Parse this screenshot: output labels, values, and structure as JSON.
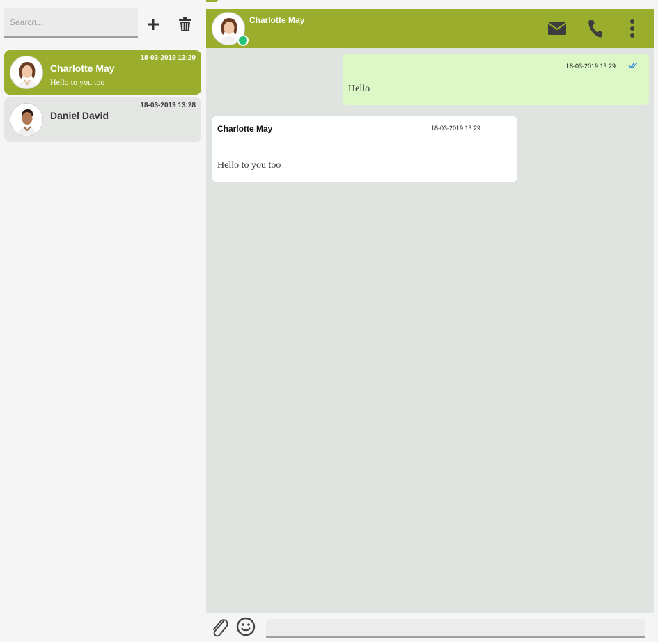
{
  "colors": {
    "accent": "#9aad2c",
    "online": "#22c377",
    "outgoing_bubble": "#dcf8c6",
    "chat_background": "#e0e4e0",
    "read_ticks": "#3a8fd6"
  },
  "sidebar": {
    "search": {
      "placeholder": "Search...",
      "value": ""
    },
    "add_icon": "plus-icon",
    "delete_icon": "trash-icon",
    "contacts": [
      {
        "name": "Charlotte May",
        "time": "18-03-2019 13:29",
        "preview": "Hello to you too",
        "active": true
      },
      {
        "name": "Daniel David",
        "time": "18-03-2019 13:28",
        "preview": "",
        "active": false
      }
    ]
  },
  "chat": {
    "header": {
      "name": "Charlotte May",
      "status": "online",
      "icons": [
        "mail-icon",
        "phone-icon",
        "more-vertical-icon"
      ]
    },
    "messages": [
      {
        "direction": "out",
        "time": "18-03-2019 13:29",
        "text": "Hello",
        "status": "read"
      },
      {
        "direction": "in",
        "sender": "Charlotte May",
        "time": "18-03-2019 13:29",
        "text": "Hello to you too"
      }
    ],
    "composer": {
      "placeholder": "",
      "value": "",
      "icons": [
        "paperclip-icon",
        "emoji-icon"
      ]
    }
  }
}
